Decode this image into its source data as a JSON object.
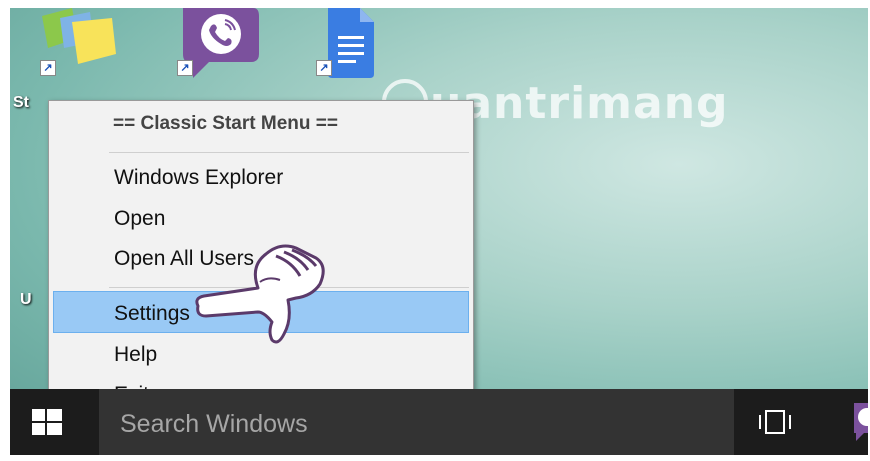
{
  "desktop": {
    "icons": [
      {
        "name": "sticky-notes",
        "label": "St"
      },
      {
        "name": "viber"
      },
      {
        "name": "google-docs"
      }
    ],
    "side_labels": [
      "U"
    ],
    "watermark": "uantrimang"
  },
  "context_menu": {
    "header": "== Classic Start Menu ==",
    "items": [
      {
        "label": "Windows Explorer"
      },
      {
        "label": "Open"
      },
      {
        "label": "Open All Users"
      },
      {
        "label": "Settings",
        "highlighted": true
      },
      {
        "label": "Help"
      },
      {
        "label": "Exit",
        "marker": "x"
      }
    ]
  },
  "taskbar": {
    "search_placeholder": "Search Windows",
    "colors": {
      "taskbar": "#1c1c1c",
      "search": "#333333",
      "highlight": "#99c9f5",
      "viber": "#7b519d"
    }
  }
}
